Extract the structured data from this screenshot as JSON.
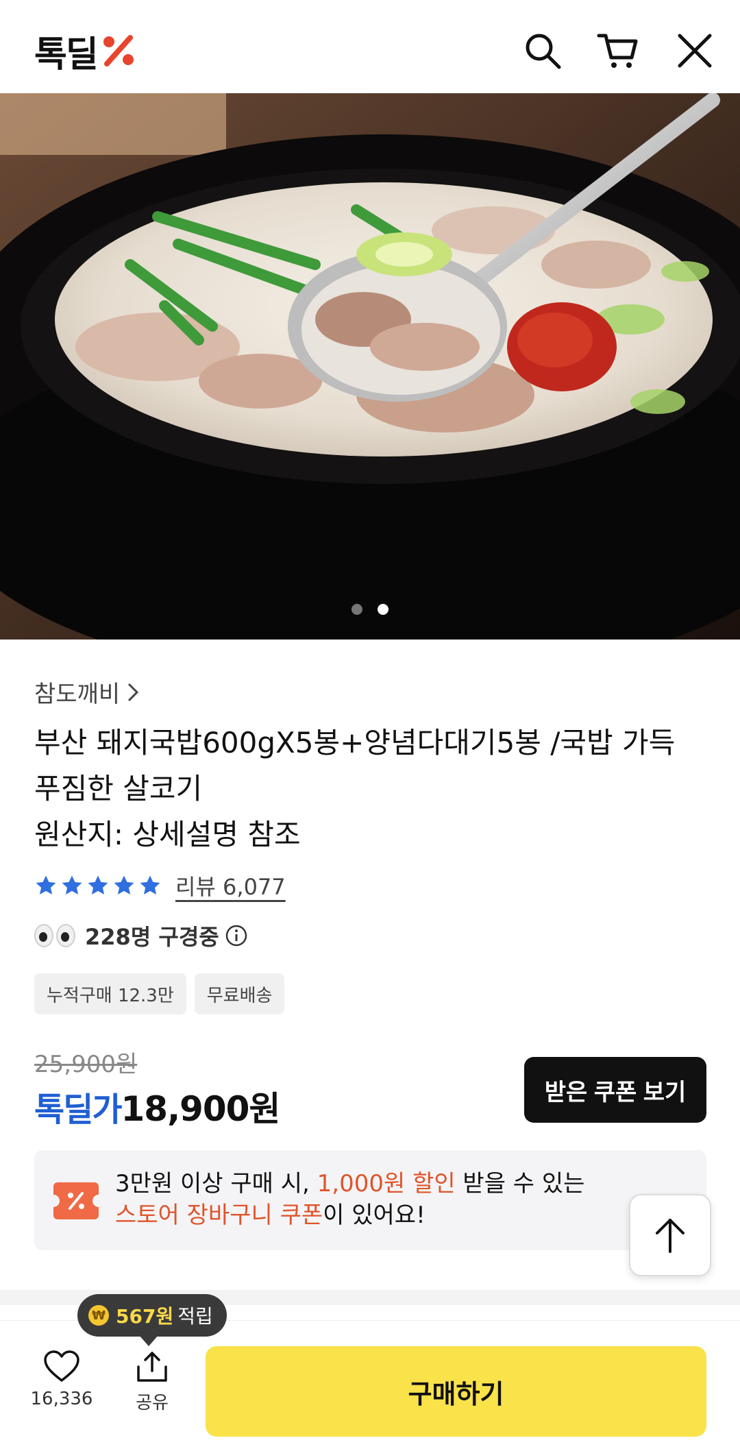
{
  "header": {
    "logo_text": "톡딜",
    "icons": [
      "search-icon",
      "cart-icon",
      "close-icon"
    ]
  },
  "hero": {
    "dots_total": 2,
    "dots_active": 2
  },
  "product": {
    "seller": "참도깨비",
    "title_line1": "부산 돼지국밥600gX5봉+양념다대기5봉 /국밥 가득",
    "title_line2": "푸짐한 살코기",
    "origin": "원산지: 상세설명 참조",
    "rating_stars": 5,
    "review_label": "리뷰 6,077",
    "viewers": "228명 구경중",
    "chips": [
      "누적구매 12.3만",
      "무료배송"
    ]
  },
  "price": {
    "original": "25,900원",
    "label": "톡딜가",
    "sale": "18,900원",
    "coupon_button": "받은 쿠폰 보기"
  },
  "banner": {
    "line1_pre": "3만원 이상 구매 시, ",
    "line1_highlight": "1,000원 할인",
    "line1_post": " 받을 수 있는",
    "line2_highlight": "스토어 장바구니 쿠폰",
    "line2_post": "이 있어요!"
  },
  "bottom": {
    "tooltip_amount": "567원",
    "tooltip_suffix": "적립",
    "like_count": "16,336",
    "share_label": "공유",
    "buy_label": "구매하기"
  },
  "colors": {
    "accent_blue": "#1f5fd1",
    "highlight_orange": "#e0542a",
    "buy_yellow": "#f9e24a",
    "star_blue": "#2f6fe0"
  }
}
